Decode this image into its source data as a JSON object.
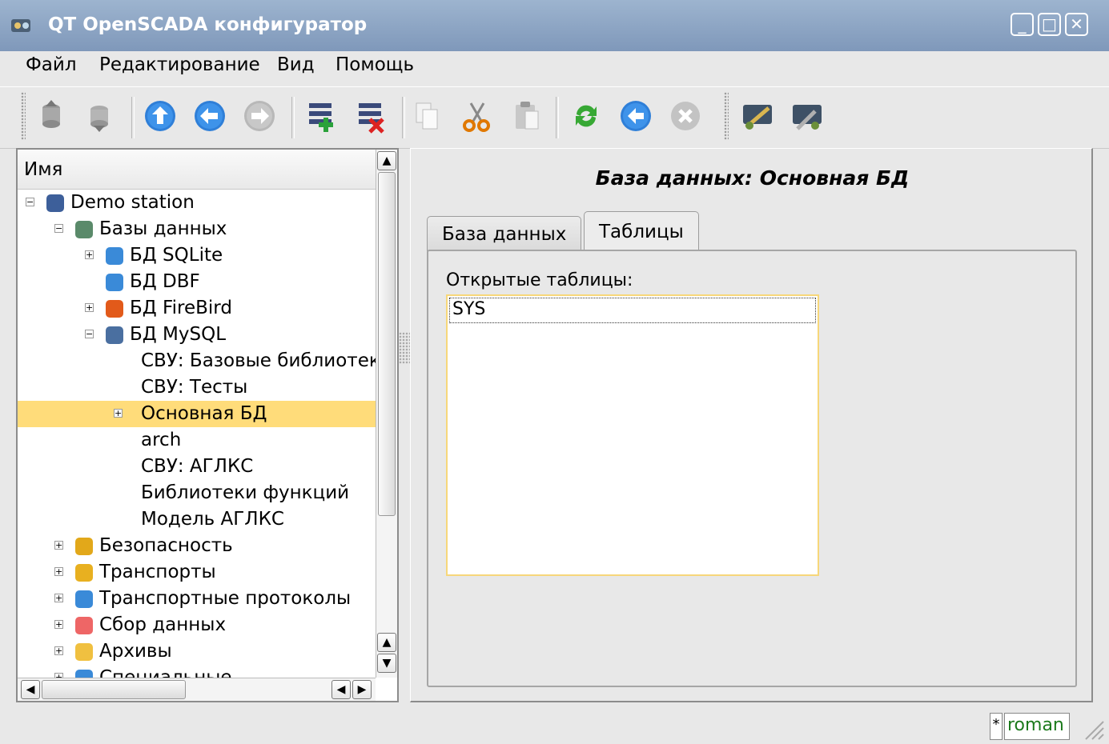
{
  "window": {
    "title": "QT OpenSCADA конфигуратор",
    "minimize_glyph": "_",
    "maximize_glyph": "□",
    "close_glyph": "✕"
  },
  "menu": [
    {
      "label": "Файл"
    },
    {
      "label": "Редактирование"
    },
    {
      "label": "Вид"
    },
    {
      "label": "Помощь"
    }
  ],
  "toolbar": {
    "icons": [
      "db-load-icon",
      "db-save-icon",
      "up-icon",
      "back-icon",
      "forward-icon",
      "add-item-icon",
      "delete-item-icon",
      "copy-icon",
      "cut-icon",
      "paste-icon",
      "refresh-icon",
      "start-icon",
      "stop-icon",
      "config-icon",
      "config-tools-icon"
    ]
  },
  "tree": {
    "header": "Имя",
    "rows": [
      {
        "label": "Demo station",
        "icon": "station-icon",
        "expander": "minus",
        "depth": 0
      },
      {
        "label": "Базы данных",
        "icon": "databases-icon",
        "expander": "minus",
        "depth": 1
      },
      {
        "label": "БД SQLite",
        "icon": "sqlite-icon",
        "expander": "plus",
        "depth": 2
      },
      {
        "label": "БД DBF",
        "icon": "dbf-icon",
        "expander": "none",
        "depth": 2
      },
      {
        "label": "БД FireBird",
        "icon": "firebird-icon",
        "expander": "plus",
        "depth": 2
      },
      {
        "label": "БД MySQL",
        "icon": "mysql-icon",
        "expander": "minus",
        "depth": 2
      },
      {
        "label": "СВУ: Базовые библиотеки",
        "icon": "",
        "expander": "none",
        "depth": 3
      },
      {
        "label": "СВУ: Тесты",
        "icon": "",
        "expander": "none",
        "depth": 3
      },
      {
        "label": "Основная БД",
        "icon": "",
        "expander": "plus",
        "depth": 3,
        "selected": true
      },
      {
        "label": "arch",
        "icon": "",
        "expander": "none",
        "depth": 3
      },
      {
        "label": "СВУ: АГЛКС",
        "icon": "",
        "expander": "none",
        "depth": 3
      },
      {
        "label": "Библиотеки функций",
        "icon": "",
        "expander": "none",
        "depth": 3
      },
      {
        "label": "Модель АГЛКС",
        "icon": "",
        "expander": "none",
        "depth": 3
      },
      {
        "label": "Безопасность",
        "icon": "security-icon",
        "expander": "plus",
        "depth": 1
      },
      {
        "label": "Транспорты",
        "icon": "transports-icon",
        "expander": "plus",
        "depth": 1
      },
      {
        "label": "Транспортные протоколы",
        "icon": "protocols-icon",
        "expander": "plus",
        "depth": 1
      },
      {
        "label": "Сбор данных",
        "icon": "data-acquisition-icon",
        "expander": "plus",
        "depth": 1
      },
      {
        "label": "Архивы",
        "icon": "archives-icon",
        "expander": "plus",
        "depth": 1
      },
      {
        "label": "Специальные",
        "icon": "specials-icon",
        "expander": "plus",
        "depth": 1
      }
    ]
  },
  "panel": {
    "title": "База данных: Основная БД",
    "tabs": [
      {
        "label": "База данных",
        "active": false
      },
      {
        "label": "Таблицы",
        "active": true
      }
    ],
    "field_label": "Открытые таблицы:",
    "list_items": [
      "SYS"
    ]
  },
  "status": {
    "modified_marker": "*",
    "user": "roman"
  },
  "colors": {
    "selection": "#ffdc7a",
    "titlebar": "#8ea7c6",
    "user_text": "#1c7a1c",
    "list_focus": "#f7d77a"
  }
}
